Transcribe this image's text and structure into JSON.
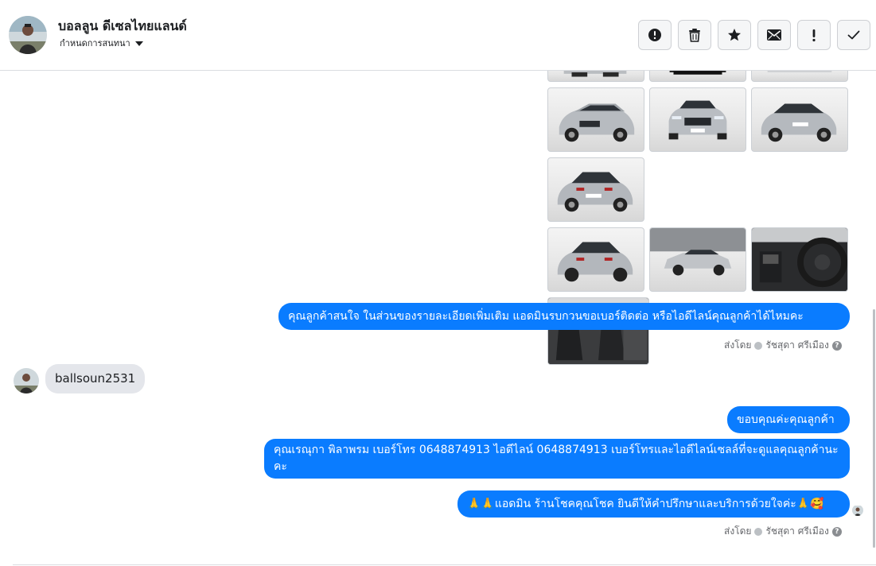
{
  "header": {
    "contact_name": "บอลลูน ดีเซลไทยแลนด์",
    "conversation_settings_label": "กำหนดการสนทนา",
    "toolbar": [
      {
        "name": "report-button",
        "icon": "alert-circle-icon"
      },
      {
        "name": "delete-button",
        "icon": "trash-icon"
      },
      {
        "name": "star-button",
        "icon": "star-icon"
      },
      {
        "name": "mark-unread-button",
        "icon": "envelope-icon"
      },
      {
        "name": "mark-important-button",
        "icon": "exclamation-icon"
      },
      {
        "name": "mark-done-button",
        "icon": "checkmark-icon"
      }
    ]
  },
  "thread": {
    "messages": [
      {
        "direction": "outgoing",
        "text": "คุณลูกค้าสนใจ ในส่วนของรายละเอียดเพิ่มเติม แอดมินรบกวนขอเบอร์ติดต่อ หรือไอดีไลน์คุณลูกค้าได้ไหมคะ"
      },
      {
        "direction": "incoming",
        "text": "ballsoun2531"
      },
      {
        "direction": "outgoing",
        "text": "ขอบคุณค่ะคุณลูกค้า"
      },
      {
        "direction": "outgoing",
        "text": "คุณเรณุกา พิลาพรม        เบอร์โทร 0648874913  ไอดีไลน์ 0648874913   เบอร์โทรและไอดีไลน์เซลล์ที่จะดูแลคุณลูกค้านะคะ"
      },
      {
        "direction": "outgoing",
        "text": "🙏🙏แอดมิน ร้านโชคคุณโชค ยินดีให้คำปรึกษาและบริการด้วยใจค่ะ🙏🥰"
      }
    ],
    "sent_by_1": {
      "label": "ส่งโดย",
      "name": "รัชสุดา ศรีเมือง"
    },
    "sent_by_2": {
      "label": "ส่งโดย",
      "name": "รัชสุดา ศรีเมือง"
    },
    "photos": [
      {
        "subject": "suv-front-left-silver",
        "tone": "light"
      },
      {
        "subject": "suv-front-silver",
        "tone": "light"
      },
      {
        "subject": "suv-rear-right-silver",
        "tone": "light"
      },
      {
        "subject": "suv-rear-left-silver",
        "tone": "light"
      },
      {
        "subject": "suv-side-silver",
        "tone": "light"
      },
      {
        "subject": "steering-wheel-interior",
        "tone": "dark"
      },
      {
        "subject": "front-seats-interior",
        "tone": "dark"
      }
    ]
  },
  "colors": {
    "outgoing_bubble": "#0a7cff",
    "incoming_bubble": "#e4e6eb",
    "toolbar_button_bg": "#f5f6f7"
  }
}
